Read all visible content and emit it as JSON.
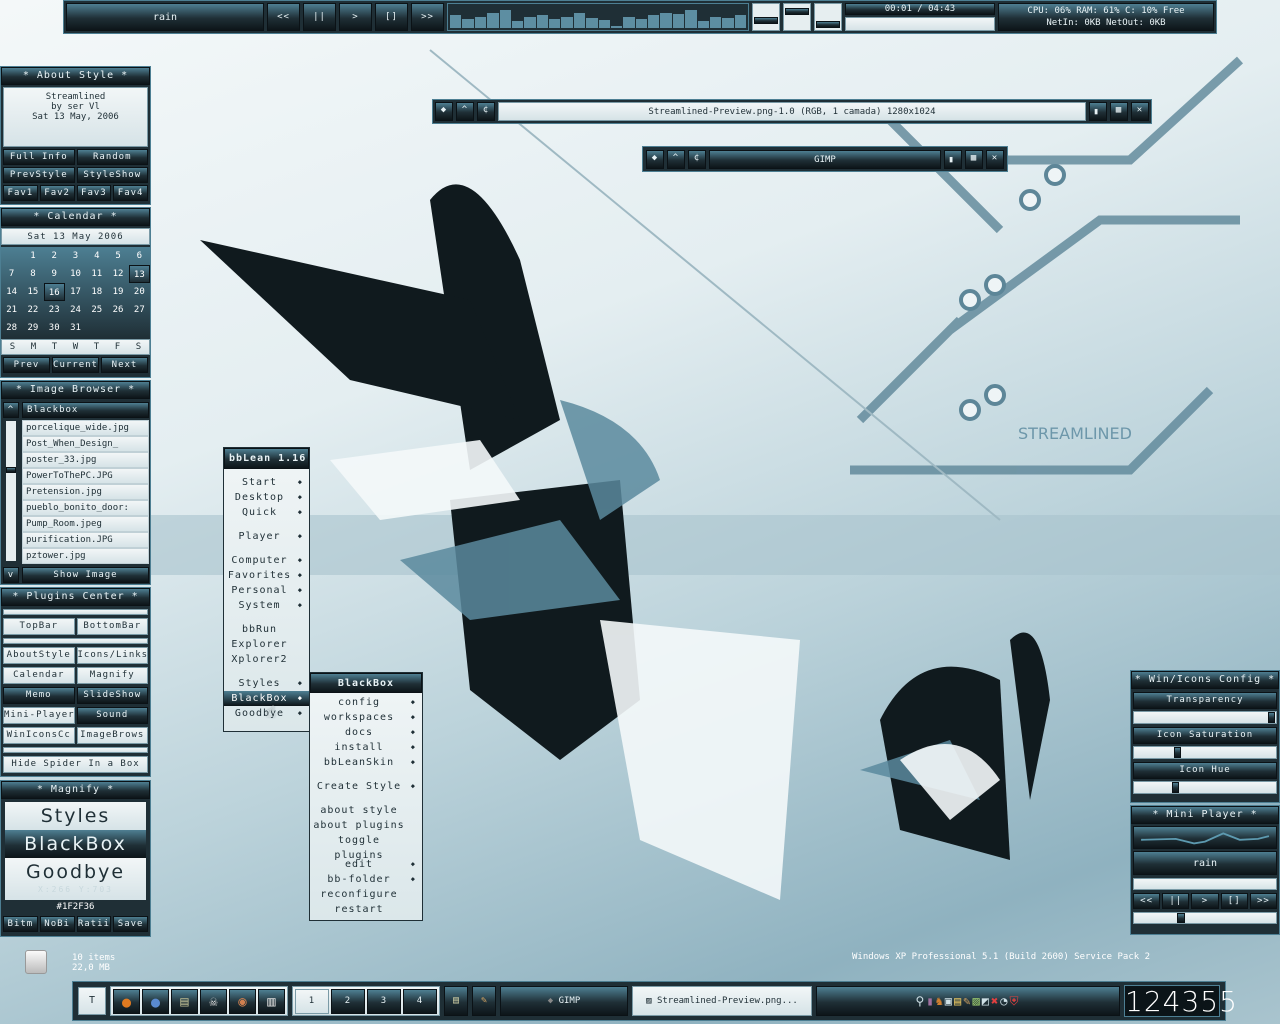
{
  "topbar": {
    "track": "rain",
    "controls": [
      "<<",
      "||",
      ">",
      "[]",
      ">>"
    ],
    "time": "00:01 / 04:43",
    "sys_line1": "CPU: 06% RAM: 61% C: 10% Free",
    "sys_line2": "NetIn: 0KB   NetOut: 0KB",
    "visualizer_levels": [
      0.6,
      0.4,
      0.5,
      0.7,
      0.8,
      0.3,
      0.5,
      0.6,
      0.4,
      0.5,
      0.7,
      0.45,
      0.35,
      0.1,
      0.5,
      0.4,
      0.6,
      0.7,
      0.65,
      0.8,
      0.3,
      0.5,
      0.45,
      0.6
    ],
    "volume_levels": [
      0.3,
      0.8,
      0.1
    ]
  },
  "about": {
    "title": "* About Style *",
    "lines": [
      "Streamlined",
      "by ser Vl",
      "Sat 13 May, 2006"
    ],
    "buttons": [
      "Full Info",
      "Random",
      "PrevStyle",
      "StyleShow"
    ],
    "favs": [
      "Fav1",
      "Fav2",
      "Fav3",
      "Fav4"
    ]
  },
  "calendar": {
    "title": "* Calendar *",
    "date": "Sat 13 May  2006",
    "first_offset": 1,
    "days": 31,
    "today": 13,
    "selected": 16,
    "weekdays": [
      "S",
      "M",
      "T",
      "W",
      "T",
      "F",
      "S"
    ],
    "nav": [
      "Prev",
      "Current",
      "Next"
    ]
  },
  "browser": {
    "title": "* Image Browser *",
    "up": "^",
    "down": "v",
    "folder": "Blackbox",
    "files": [
      "porcelique_wide.jpg",
      "Post_When_Design_",
      "poster_33.jpg",
      "PowerToThePC.JPG",
      "Pretension.jpg",
      "pueblo_bonito_door:",
      "Pump_Room.jpeg",
      "purification.JPG",
      "pztower.jpg"
    ],
    "show": "Show Image",
    "scroll_position": 0.35
  },
  "plugins": {
    "title": "* Plugins Center *",
    "rows": [
      [
        "TopBar",
        "BottomBar"
      ],
      [
        "AboutStyle",
        "Icons/Links"
      ],
      [
        "Calendar",
        "Magnify"
      ],
      [
        "Memo",
        "SlideShow"
      ],
      [
        "Mini-Player",
        "Sound"
      ],
      [
        "WinIconsCc",
        "ImageBrows"
      ]
    ],
    "active": [
      "Memo",
      "SlideShow",
      "Sound"
    ],
    "hide": "Hide Spider In a Box"
  },
  "magnify": {
    "title": "* Magnify *",
    "words": [
      "Styles",
      "BlackBox",
      "Goodbye"
    ],
    "coords": "X:266 Y:703",
    "color": "#1F2F36",
    "buttons": [
      "Bitm",
      "NoBi",
      "Ratii",
      "Save"
    ]
  },
  "menu": {
    "title": "bbLean 1.16",
    "items": [
      {
        "label": "Start",
        "sub": true
      },
      {
        "label": "Desktop",
        "sub": true
      },
      {
        "label": "Quick",
        "sub": true
      },
      {
        "gap": true
      },
      {
        "label": "Player",
        "sub": true
      },
      {
        "gap": true
      },
      {
        "label": "Computer",
        "sub": true
      },
      {
        "label": "Favorites",
        "sub": true
      },
      {
        "label": "Personal",
        "sub": true
      },
      {
        "label": "System",
        "sub": true
      },
      {
        "gap": true
      },
      {
        "label": "bbRun"
      },
      {
        "label": "Explorer"
      },
      {
        "label": "Xplorer2"
      },
      {
        "gap": true
      },
      {
        "label": "Styles",
        "sub": true
      },
      {
        "label": "BlackBox",
        "sub": true,
        "active": true
      },
      {
        "label": "Goodbye",
        "sub": true
      }
    ]
  },
  "submenu": {
    "title": "BlackBox",
    "items": [
      {
        "label": "config",
        "sub": true
      },
      {
        "label": "workspaces",
        "sub": true
      },
      {
        "label": "docs",
        "sub": true
      },
      {
        "label": "install",
        "sub": true
      },
      {
        "label": "bbLeanSkin",
        "sub": true
      },
      {
        "gap": true
      },
      {
        "label": "Create Style",
        "sub": true
      },
      {
        "gap": true
      },
      {
        "label": "about style"
      },
      {
        "label": "about plugins"
      },
      {
        "label": "toggle plugins"
      },
      {
        "gap": true
      },
      {
        "label": "edit",
        "sub": true
      },
      {
        "label": "bb-folder",
        "sub": true
      },
      {
        "label": "reconfigure"
      },
      {
        "label": "restart"
      }
    ]
  },
  "windows": {
    "preview_title": "Streamlined-Preview.png-1.0 (RGB, 1 camada) 1280x1024",
    "gimp_title": "GIMP"
  },
  "winicons": {
    "title": "* Win/Icons Config *",
    "sliders": [
      {
        "label": "Transparency",
        "value": 1.0
      },
      {
        "label": "Icon Saturation",
        "value": 0.3
      },
      {
        "label": "Icon Hue",
        "value": 0.28
      }
    ]
  },
  "miniplayer": {
    "title": "* Mini Player *",
    "track": "rain",
    "controls": [
      "<<",
      "||",
      ">",
      "[]",
      ">>"
    ],
    "position": 0.33
  },
  "desktop": {
    "trash_count": "10 items",
    "trash_size": "22,0 MB",
    "os": "Windows XP Professional 5.1 (Build 2600) Service Pack 2",
    "wallpaper_text": "STREAMLINED"
  },
  "taskbar": {
    "toggle": "T",
    "workspaces": [
      "1",
      "2",
      "3",
      "4"
    ],
    "current_workspace": "1",
    "tasks": [
      "GIMP",
      "Streamlined-Preview.png..."
    ],
    "clock": "124355"
  }
}
